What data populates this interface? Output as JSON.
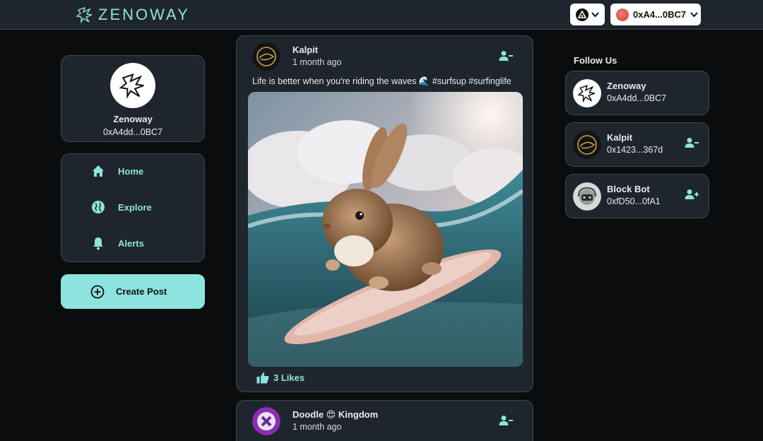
{
  "brand": {
    "name": "ZENOWAY"
  },
  "header": {
    "wallet_address": "0xA4...0BC7"
  },
  "profile": {
    "name": "Zenoway",
    "address": "0xA4dd...0BC7"
  },
  "nav": {
    "items": [
      {
        "label": "Home",
        "icon": "home-icon"
      },
      {
        "label": "Explore",
        "icon": "globe-icon"
      },
      {
        "label": "Alerts",
        "icon": "bell-icon"
      }
    ]
  },
  "create_post": {
    "label": "Create Post",
    "icon": "plus-circle-icon"
  },
  "posts": [
    {
      "author": "Kalpit",
      "time": "1 month ago",
      "text": "Life is better when you're riding the waves 🌊 #surfsup #surfinglife",
      "likes": "3 Likes"
    },
    {
      "author": "Doodle 😍 Kingdom",
      "time": "1 month ago"
    }
  ],
  "follow": {
    "title": "Follow Us",
    "accounts": [
      {
        "name": "Zenoway",
        "address": "0xA4dd...0BC7"
      },
      {
        "name": "Kalpit",
        "address": "0x1423...367d",
        "action": "unfollow"
      },
      {
        "name": "Block Bot",
        "address": "0xfD50...0fA1",
        "action": "follow"
      }
    ]
  },
  "colors": {
    "accent": "#8de3dd",
    "card": "#1e252d",
    "background": "#0b0c0e",
    "border": "#3a4a4f"
  }
}
